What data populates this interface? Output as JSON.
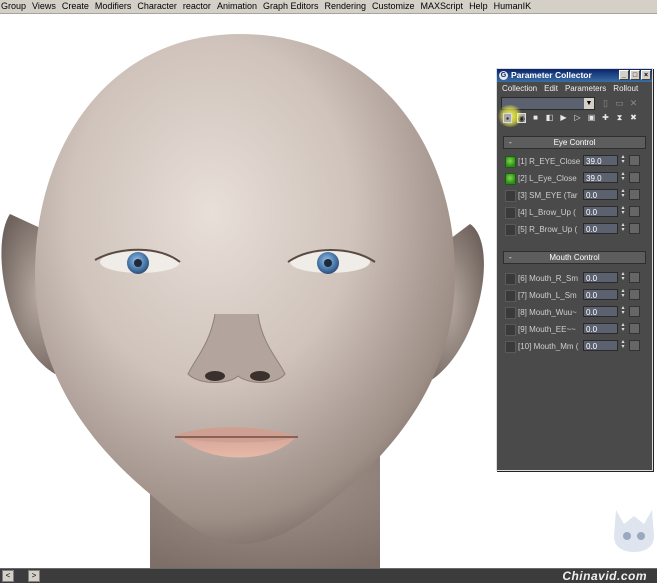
{
  "menubar": {
    "items": [
      "Group",
      "Views",
      "Create",
      "Modifiers",
      "Character",
      "reactor",
      "Animation",
      "Graph Editors",
      "Rendering",
      "Customize",
      "MAXScript",
      "Help",
      "HumanIK"
    ]
  },
  "collector": {
    "title": "Parameter Collector",
    "menu": [
      "Collection",
      "Edit",
      "Parameters",
      "Rollout"
    ],
    "rollouts": [
      {
        "title": "Eye Control",
        "params": [
          {
            "label": "[1] R_EYE_Close",
            "value": "39.0",
            "checked": true
          },
          {
            "label": "[2] L_Eye_Close",
            "value": "39.0",
            "checked": true
          },
          {
            "label": "[3] SM_EYE  (Tar",
            "value": "0.0",
            "checked": false
          },
          {
            "label": "[4] L_Brow_Up  (",
            "value": "0.0",
            "checked": false
          },
          {
            "label": "[5] R_Brow_Up  (",
            "value": "0.0",
            "checked": false
          }
        ]
      },
      {
        "title": "Mouth Control",
        "params": [
          {
            "label": "[6] Mouth_R_Sm",
            "value": "0.0",
            "checked": false
          },
          {
            "label": "[7] Mouth_L_Sm",
            "value": "0.0",
            "checked": false
          },
          {
            "label": "[8] Mouth_Wuu~",
            "value": "0.0",
            "checked": false
          },
          {
            "label": "[9] Mouth_EE~~",
            "value": "0.0",
            "checked": false
          },
          {
            "label": "[10] Mouth_Mm  (",
            "value": "0.0",
            "checked": false
          }
        ]
      }
    ]
  },
  "bottombar": {
    "left_button": "<",
    "right_button": ">",
    "watermark": "Chinavid.com"
  },
  "colors": {
    "panel_bg": "#4a4a4a",
    "titlebar": "#0a246a",
    "checked_green": "#4cb02e",
    "highlight": "#ffff50"
  }
}
